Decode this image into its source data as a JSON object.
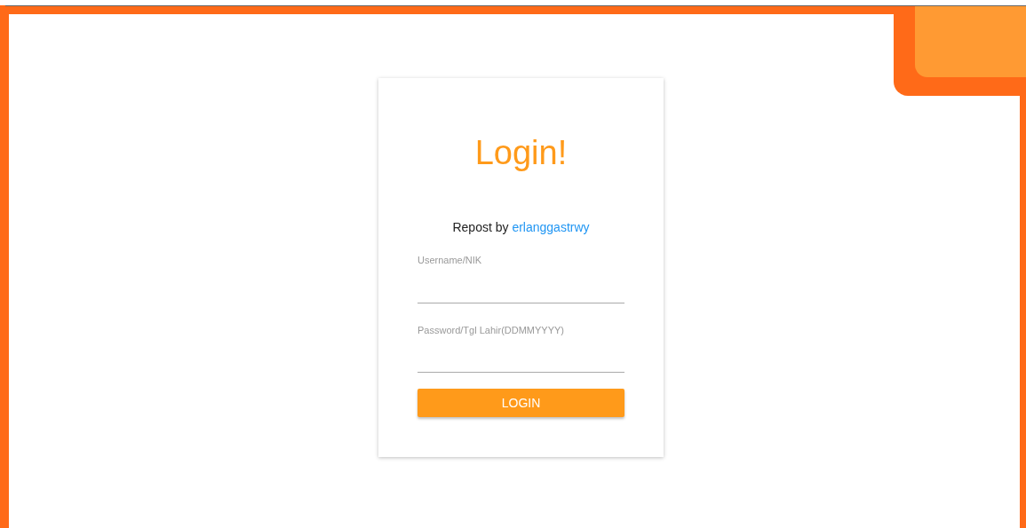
{
  "login_card": {
    "title": "Login!",
    "credit": {
      "text": "Repost by",
      "link": "erlanggastrwy"
    },
    "fields": [
      {
        "label": "Username/NIK"
      },
      {
        "label": "Password/Tgl Lahir(DDMMYYYY)"
      }
    ],
    "button": "LOGIN"
  }
}
